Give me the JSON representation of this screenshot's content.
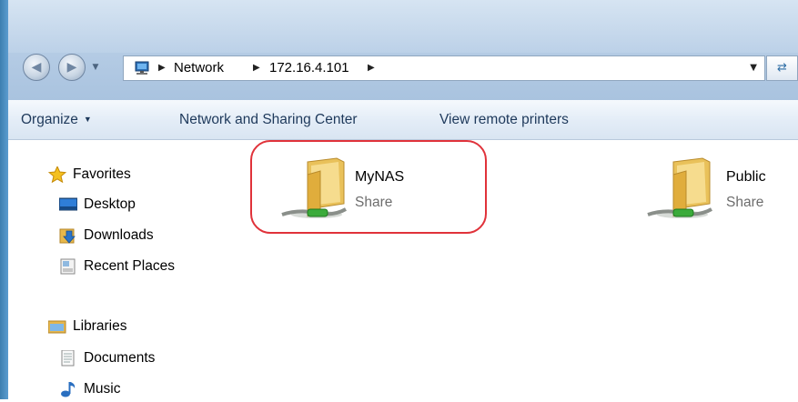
{
  "address": {
    "crumbs": [
      "Network",
      "172.16.4.101"
    ]
  },
  "toolbar": {
    "organize": "Organize",
    "network_sharing": "Network and Sharing Center",
    "view_printers": "View remote printers"
  },
  "navpane": {
    "favorites": {
      "label": "Favorites",
      "items": [
        "Desktop",
        "Downloads",
        "Recent Places"
      ]
    },
    "libraries": {
      "label": "Libraries",
      "items": [
        "Documents",
        "Music"
      ]
    }
  },
  "shares": [
    {
      "name": "MyNAS",
      "type": "Share",
      "highlighted": true
    },
    {
      "name": "Public",
      "type": "Share",
      "highlighted": false
    }
  ],
  "colors": {
    "highlight": "#e0323a",
    "toolbar_text": "#1e395b"
  }
}
